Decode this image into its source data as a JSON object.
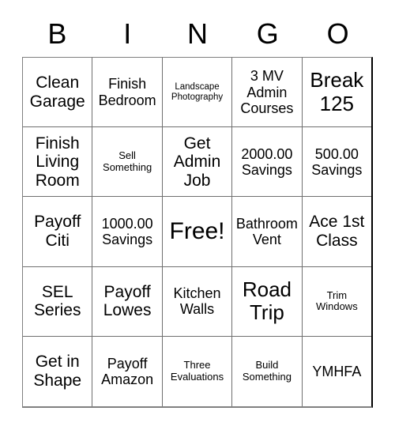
{
  "card": {
    "headers": [
      "B",
      "I",
      "N",
      "G",
      "O"
    ],
    "rows": [
      [
        {
          "text": "Clean Garage",
          "size": "md"
        },
        {
          "text": "Finish Bedroom",
          "size": "sm"
        },
        {
          "text": "Landscape Photography",
          "size": "xxs"
        },
        {
          "text": "3 MV Admin Courses",
          "size": "sm"
        },
        {
          "text": "Break 125",
          "size": "lg"
        }
      ],
      [
        {
          "text": "Finish Living Room",
          "size": "md"
        },
        {
          "text": "Sell Something",
          "size": "xs"
        },
        {
          "text": "Get Admin Job",
          "size": "md"
        },
        {
          "text": "2000.00 Savings",
          "size": "sm"
        },
        {
          "text": "500.00 Savings",
          "size": "sm"
        }
      ],
      [
        {
          "text": "Payoff Citi",
          "size": "md"
        },
        {
          "text": "1000.00 Savings",
          "size": "sm"
        },
        {
          "text": "Free!",
          "size": "xl"
        },
        {
          "text": "Bathroom Vent",
          "size": "sm"
        },
        {
          "text": "Ace 1st Class",
          "size": "md"
        }
      ],
      [
        {
          "text": "SEL Series",
          "size": "md"
        },
        {
          "text": "Payoff Lowes",
          "size": "md"
        },
        {
          "text": "Kitchen Walls",
          "size": "sm"
        },
        {
          "text": "Road Trip",
          "size": "lg"
        },
        {
          "text": "Trim Windows",
          "size": "xs"
        }
      ],
      [
        {
          "text": "Get in Shape",
          "size": "md"
        },
        {
          "text": "Payoff Amazon",
          "size": "sm"
        },
        {
          "text": "Three Evaluations",
          "size": "xs"
        },
        {
          "text": "Build Something",
          "size": "xs"
        },
        {
          "text": "YMHFA",
          "size": "sm"
        }
      ]
    ]
  }
}
